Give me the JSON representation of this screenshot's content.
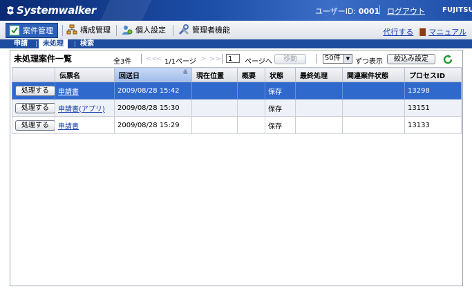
{
  "header": {
    "logo": "Systemwalker",
    "user_label": "ユーザーID: ",
    "user_id": "0001",
    "logout": "ログアウト",
    "brand": "FUJITSU"
  },
  "menu": {
    "items": [
      {
        "label": "案件管理",
        "icon": "checklist-icon"
      },
      {
        "label": "構成管理",
        "icon": "org-chart-icon"
      },
      {
        "label": "個人設定",
        "icon": "person-settings-icon"
      },
      {
        "label": "管理者機能",
        "icon": "tools-icon"
      }
    ],
    "proxy": "代行する",
    "manual": "マニュアル"
  },
  "subtabs": [
    "申請",
    "未処理",
    "検索"
  ],
  "list": {
    "title": "未処理案件一覧",
    "total": "全3件",
    "first": "<<",
    "prev": "<",
    "page_info": "1/1ページ",
    "next": ">",
    "last": ">>",
    "page_value": "1",
    "page_suffix": "ページへ",
    "move_button": "移動",
    "per_page": "50件",
    "per_page_suffix": "ずつ表示",
    "filter_button": "絞込み設定"
  },
  "table": {
    "columns": [
      "",
      "伝票名",
      "回送日",
      "現在位置",
      "概要",
      "状態",
      "最終処理",
      "関連案件状態",
      "プロセスID"
    ],
    "action_label": "処理する",
    "rows": [
      {
        "name": "申請書",
        "date": "2009/08/28 15:42",
        "location": "",
        "summary": "",
        "status": "保存",
        "last": "",
        "related": "",
        "pid": "13298"
      },
      {
        "name": "申請書(アプリ)",
        "date": "2009/08/28 15:30",
        "location": "",
        "summary": "",
        "status": "保存",
        "last": "",
        "related": "",
        "pid": "13151"
      },
      {
        "name": "申請書",
        "date": "2009/08/28 15:29",
        "location": "",
        "summary": "",
        "status": "保存",
        "last": "",
        "related": "",
        "pid": "13133"
      }
    ]
  },
  "colors": {
    "header_blue": "#1d4fa8",
    "selected_row": "#2f69cc"
  }
}
